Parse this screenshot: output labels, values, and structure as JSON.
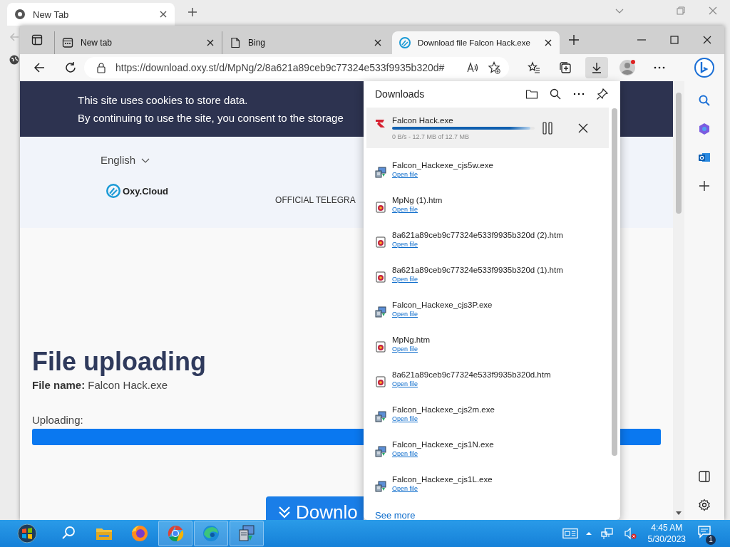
{
  "back_window": {
    "tab": {
      "title": "New Tab"
    }
  },
  "window": {
    "tabs": [
      {
        "title": "New tab",
        "kind": "start-page",
        "selected": false
      },
      {
        "title": "Bing",
        "kind": "blank-page",
        "selected": false
      },
      {
        "title": "Download file Falcon Hack.exe",
        "kind": "site",
        "selected": true
      }
    ],
    "address": "https://download.oxy.st/d/MpNg/2/8a621a89ceb9c77324e533f9935b320d#"
  },
  "page": {
    "cookie_banner": [
      "This site uses cookies to store data.",
      "By continuing to use the site, you consent to the storage"
    ],
    "language": "English",
    "logo": "Oxy.Cloud",
    "nav_link": "OFFICIAL TELEGRA",
    "heading": "File uploading",
    "file_name_label": "File name:",
    "file_name": "Falcon Hack.exe",
    "progress_label": "Uploading:",
    "progress": {
      "level": 1
    },
    "button": "Downlo"
  },
  "downloads": {
    "title": "Downloads",
    "items": [
      {
        "name": "Falcon Hack.exe",
        "kind": "in-progress",
        "status": "0 B/s - 12.7 MB of 12.7 MB",
        "level": 0.97
      },
      {
        "name": "Falcon_Hackexe_cjs5w.exe",
        "kind": "program",
        "link": "Open file"
      },
      {
        "name": "MpNg (1).htm",
        "kind": "web-page",
        "link": "Open file"
      },
      {
        "name": "8a621a89ceb9c77324e533f9935b320d (2).htm",
        "kind": "web-page",
        "link": "Open file"
      },
      {
        "name": "8a621a89ceb9c77324e533f9935b320d (1).htm",
        "kind": "web-page",
        "link": "Open file"
      },
      {
        "name": "Falcon_Hackexe_cjs3P.exe",
        "kind": "program",
        "link": "Open file"
      },
      {
        "name": "MpNg.htm",
        "kind": "web-page",
        "link": "Open file"
      },
      {
        "name": "8a621a89ceb9c77324e533f9935b320d.htm",
        "kind": "web-page",
        "link": "Open file"
      },
      {
        "name": "Falcon_Hackexe_cjs2m.exe",
        "kind": "program",
        "link": "Open file"
      },
      {
        "name": "Falcon_Hackexe_cjs1N.exe",
        "kind": "program",
        "link": "Open file"
      },
      {
        "name": "Falcon_Hackexe_cjs1L.exe",
        "kind": "program",
        "link": "Open file"
      }
    ],
    "see_more": "See more"
  },
  "taskbar": {
    "apps": [
      {
        "kind": "start",
        "running": false
      },
      {
        "kind": "search",
        "running": false
      },
      {
        "kind": "folder",
        "running": false
      },
      {
        "kind": "firefox",
        "running": false
      },
      {
        "kind": "chrome",
        "running": true
      },
      {
        "kind": "edge",
        "running": true
      },
      {
        "kind": "installer",
        "running": true
      }
    ],
    "time": "4:45 AM",
    "date": "5/30/2023",
    "notifications": "1"
  }
}
